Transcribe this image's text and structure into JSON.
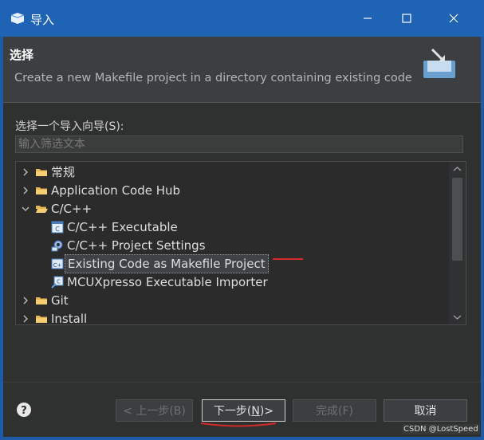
{
  "window": {
    "title": "导入"
  },
  "header": {
    "title": "选择",
    "description": "Create a new Makefile project in a directory containing existing code"
  },
  "wizard_label": "选择一个导入向导(S):",
  "filter": {
    "placeholder": "输入筛选文本",
    "value": ""
  },
  "tree": [
    {
      "label": "常规",
      "level": 0,
      "expanded": false,
      "icon": "folder-icon"
    },
    {
      "label": "Application Code Hub",
      "level": 0,
      "expanded": false,
      "icon": "folder-icon"
    },
    {
      "label": "C/C++",
      "level": 0,
      "expanded": true,
      "icon": "folder-icon"
    },
    {
      "label": "C/C++ Executable",
      "level": 1,
      "icon": "c-executable-icon"
    },
    {
      "label": "C/C++ Project Settings",
      "level": 1,
      "icon": "project-settings-icon"
    },
    {
      "label": "Existing Code as Makefile Project",
      "level": 1,
      "icon": "makefile-project-icon",
      "selected": true
    },
    {
      "label": "MCUXpresso Executable Importer",
      "level": 1,
      "icon": "mcuxpresso-icon"
    },
    {
      "label": "Git",
      "level": 0,
      "expanded": false,
      "icon": "folder-icon"
    },
    {
      "label": "Install",
      "level": 0,
      "expanded": false,
      "icon": "folder-icon"
    }
  ],
  "buttons": {
    "back": "< 上一步(B)",
    "next_prefix": "下一步(",
    "next_mnemonic": "N",
    "next_suffix": ")>",
    "finish": "完成(F)",
    "cancel": "取消"
  },
  "watermark": "CSDN @LostSpeed",
  "colors": {
    "title_bar": "#1f63b4",
    "annotation_red": "#d42a2a"
  }
}
